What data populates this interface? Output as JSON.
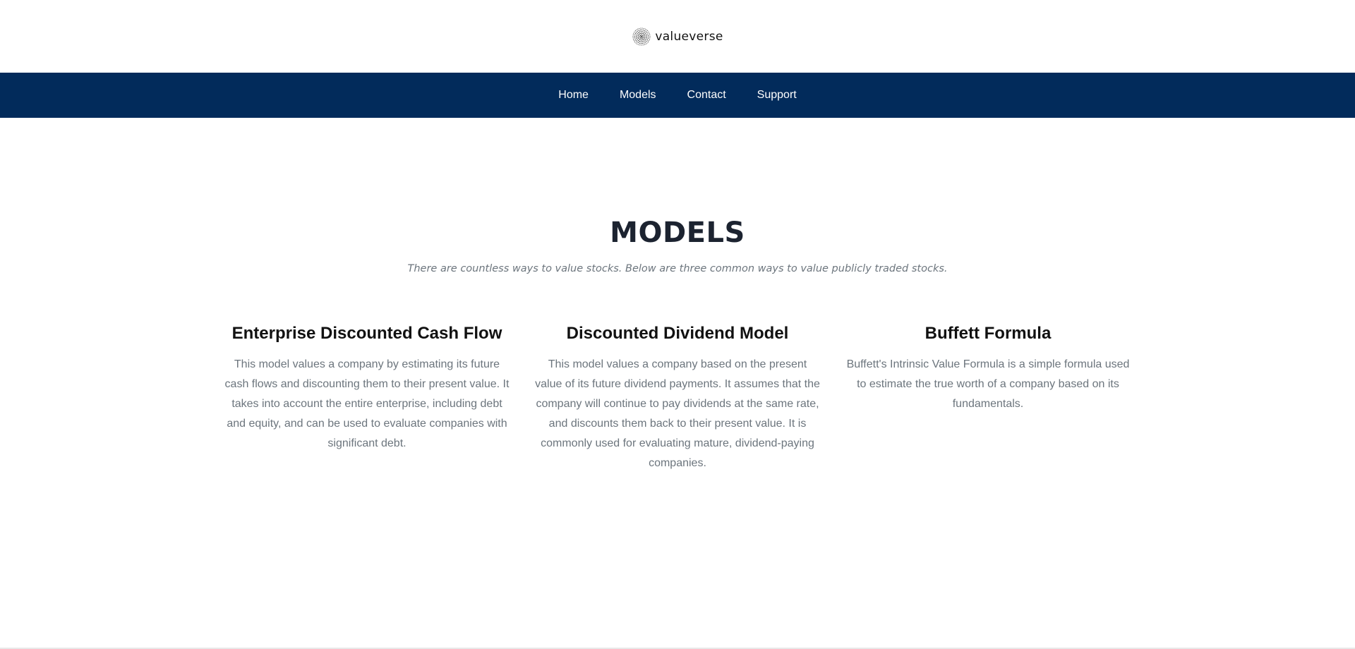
{
  "brand": {
    "name": "valueverse",
    "icon": "dotted-globe-logo-icon"
  },
  "nav": {
    "items": [
      {
        "label": "Home"
      },
      {
        "label": "Models"
      },
      {
        "label": "Contact"
      },
      {
        "label": "Support"
      }
    ],
    "bg_color": "#022b5b"
  },
  "section": {
    "title": "MODELS",
    "subtitle": "There are countless ways to value stocks. Below are three common ways to value publicly traded stocks."
  },
  "models": [
    {
      "title": "Enterprise Discounted Cash Flow",
      "description": "This model values a company by estimating its future cash flows and discounting them to their present value. It takes into account the entire enterprise, including debt and equity, and can be used to evaluate companies with significant debt."
    },
    {
      "title": "Discounted Dividend Model",
      "description": "This model values a company based on the present value of its future dividend payments. It assumes that the company will continue to pay dividends at the same rate, and discounts them back to their present value. It is commonly used for evaluating mature, dividend-paying companies."
    },
    {
      "title": "Buffett Formula",
      "description": "Buffett's Intrinsic Value Formula is a simple formula used to estimate the true worth of a company based on its fundamentals."
    }
  ]
}
